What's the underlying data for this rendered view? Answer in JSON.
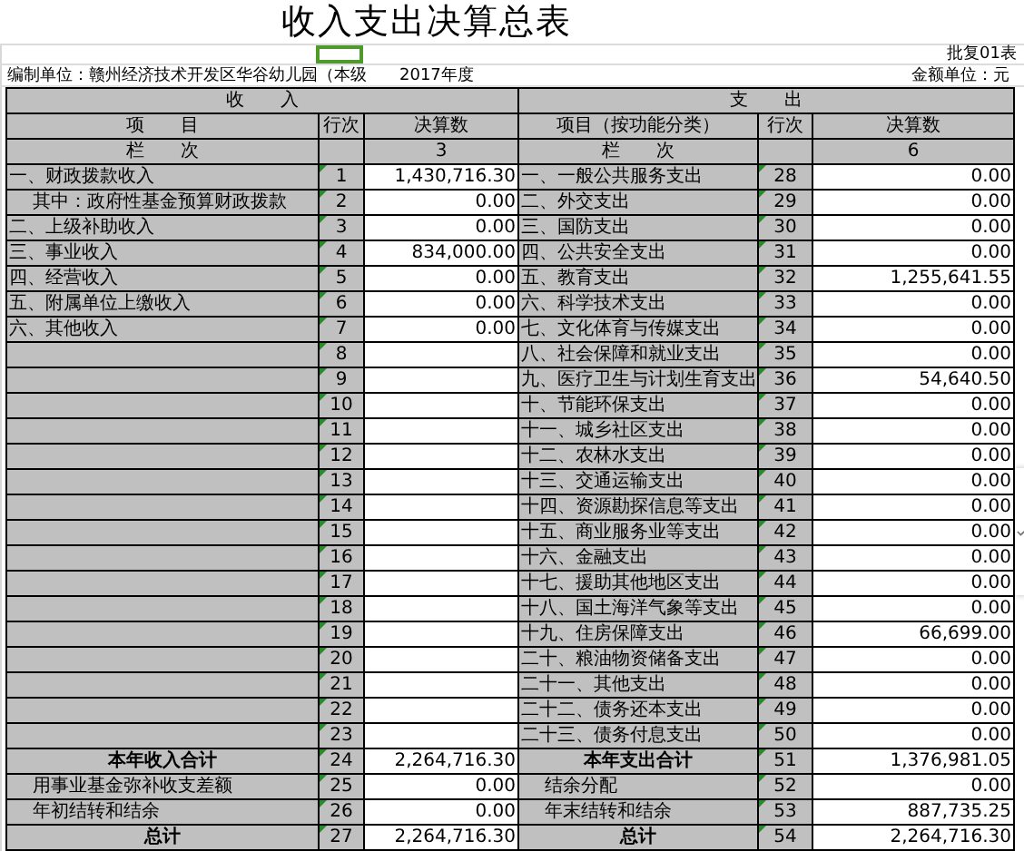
{
  "title": "收入支出决算总表",
  "approval_no": "批复01表",
  "unit": "编制单位：赣州经济技术开发区华谷幼儿园（本级",
  "year": "2017年度",
  "currency_unit": "金额单位：元",
  "sections": [
    "收　　入",
    "支　　出"
  ],
  "columns": [
    "项　　目",
    "行次",
    "决算数",
    "项目（按功能分类）",
    "行次",
    "决算数"
  ],
  "column_numbers": {
    "income_item": "栏　　次",
    "income_amount": "3",
    "expense_item": "栏　　次",
    "expense_amount": "6"
  },
  "rows": [
    {
      "income": {
        "item": "一、财政拨款收入",
        "line": "1",
        "amount": "1,430,716.30",
        "kind": "normal"
      },
      "expense": {
        "item": "一、一般公共服务支出",
        "line": "28",
        "amount": "0.00",
        "kind": "normal"
      }
    },
    {
      "income": {
        "item": "其中：政府性基金预算财政拨款",
        "line": "2",
        "amount": "0.00",
        "kind": "sub"
      },
      "expense": {
        "item": "二、外交支出",
        "line": "29",
        "amount": "0.00",
        "kind": "normal"
      }
    },
    {
      "income": {
        "item": "二、上级补助收入",
        "line": "3",
        "amount": "0.00",
        "kind": "normal"
      },
      "expense": {
        "item": "三、国防支出",
        "line": "30",
        "amount": "0.00",
        "kind": "normal"
      }
    },
    {
      "income": {
        "item": "三、事业收入",
        "line": "4",
        "amount": "834,000.00",
        "kind": "normal"
      },
      "expense": {
        "item": "四、公共安全支出",
        "line": "31",
        "amount": "0.00",
        "kind": "normal"
      }
    },
    {
      "income": {
        "item": "四、经营收入",
        "line": "5",
        "amount": "0.00",
        "kind": "normal"
      },
      "expense": {
        "item": "五、教育支出",
        "line": "32",
        "amount": "1,255,641.55",
        "kind": "normal"
      }
    },
    {
      "income": {
        "item": "五、附属单位上缴收入",
        "line": "6",
        "amount": "0.00",
        "kind": "normal"
      },
      "expense": {
        "item": "六、科学技术支出",
        "line": "33",
        "amount": "0.00",
        "kind": "normal"
      }
    },
    {
      "income": {
        "item": "六、其他收入",
        "line": "7",
        "amount": "0.00",
        "kind": "normal"
      },
      "expense": {
        "item": "七、文化体育与传媒支出",
        "line": "34",
        "amount": "0.00",
        "kind": "normal"
      }
    },
    {
      "income": {
        "line": "8",
        "kind": "normal"
      },
      "expense": {
        "item": "八、社会保障和就业支出",
        "line": "35",
        "amount": "0.00",
        "kind": "normal"
      }
    },
    {
      "income": {
        "line": "9",
        "kind": "normal"
      },
      "expense": {
        "item": "九、医疗卫生与计划生育支出",
        "line": "36",
        "amount": "54,640.50",
        "kind": "normal"
      }
    },
    {
      "income": {
        "line": "10",
        "kind": "normal"
      },
      "expense": {
        "item": "十、节能环保支出",
        "line": "37",
        "amount": "0.00",
        "kind": "normal"
      }
    },
    {
      "income": {
        "line": "11",
        "kind": "normal"
      },
      "expense": {
        "item": "十一、城乡社区支出",
        "line": "38",
        "amount": "0.00",
        "kind": "normal"
      }
    },
    {
      "income": {
        "line": "12",
        "kind": "normal"
      },
      "expense": {
        "item": "十二、农林水支出",
        "line": "39",
        "amount": "0.00",
        "kind": "normal"
      }
    },
    {
      "income": {
        "line": "13",
        "kind": "normal"
      },
      "expense": {
        "item": "十三、交通运输支出",
        "line": "40",
        "amount": "0.00",
        "kind": "normal"
      }
    },
    {
      "income": {
        "line": "14",
        "kind": "normal"
      },
      "expense": {
        "item": "十四、资源勘探信息等支出",
        "line": "41",
        "amount": "0.00",
        "kind": "normal"
      }
    },
    {
      "income": {
        "line": "15",
        "kind": "normal"
      },
      "expense": {
        "item": "十五、商业服务业等支出",
        "line": "42",
        "amount": "0.00",
        "kind": "normal"
      }
    },
    {
      "income": {
        "line": "16",
        "kind": "normal"
      },
      "expense": {
        "item": "十六、金融支出",
        "line": "43",
        "amount": "0.00",
        "kind": "normal"
      }
    },
    {
      "income": {
        "line": "17",
        "kind": "normal"
      },
      "expense": {
        "item": "十七、援助其他地区支出",
        "line": "44",
        "amount": "0.00",
        "kind": "normal"
      }
    },
    {
      "income": {
        "line": "18",
        "kind": "normal"
      },
      "expense": {
        "item": "十八、国土海洋气象等支出",
        "line": "45",
        "amount": "0.00",
        "kind": "normal"
      }
    },
    {
      "income": {
        "line": "19",
        "kind": "normal"
      },
      "expense": {
        "item": "十九、住房保障支出",
        "line": "46",
        "amount": "66,699.00",
        "kind": "normal"
      }
    },
    {
      "income": {
        "line": "20",
        "kind": "normal"
      },
      "expense": {
        "item": "二十、粮油物资储备支出",
        "line": "47",
        "amount": "0.00",
        "kind": "normal"
      }
    },
    {
      "income": {
        "line": "21",
        "kind": "normal"
      },
      "expense": {
        "item": "二十一、其他支出",
        "line": "48",
        "amount": "0.00",
        "kind": "normal"
      }
    },
    {
      "income": {
        "line": "22",
        "kind": "normal"
      },
      "expense": {
        "item": "二十二、债务还本支出",
        "line": "49",
        "amount": "0.00",
        "kind": "normal"
      }
    },
    {
      "income": {
        "line": "23",
        "kind": "normal"
      },
      "expense": {
        "item": "二十三、债务付息支出",
        "line": "50",
        "amount": "0.00",
        "kind": "normal"
      }
    },
    {
      "income": {
        "item": "本年收入合计",
        "line": "24",
        "amount": "2,264,716.30",
        "kind": "total"
      },
      "expense": {
        "item": "本年支出合计",
        "line": "51",
        "amount": "1,376,981.05",
        "kind": "total"
      }
    },
    {
      "income": {
        "item": "用事业基金弥补收支差额",
        "line": "25",
        "amount": "0.00",
        "kind": "sub"
      },
      "expense": {
        "item": "结余分配",
        "line": "52",
        "amount": "0.00",
        "kind": "sub"
      }
    },
    {
      "income": {
        "item": "年初结转和结余",
        "line": "26",
        "amount": "0.00",
        "kind": "sub"
      },
      "expense": {
        "item": "年末结转和结余",
        "line": "53",
        "amount": "887,735.25",
        "kind": "sub"
      }
    },
    {
      "income": {
        "item": "总计",
        "line": "27",
        "amount": "2,264,716.30",
        "kind": "total"
      },
      "expense": {
        "item": "总计",
        "line": "54",
        "amount": "2,264,716.30",
        "kind": "total"
      }
    }
  ]
}
